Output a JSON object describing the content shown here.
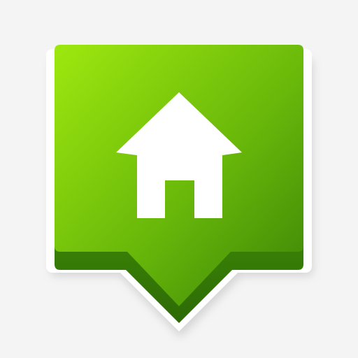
{
  "icon": {
    "name": "home-location-pin-icon",
    "colors": {
      "background": "#f4f4f4",
      "pin_light": "#9ee80f",
      "pin_mid": "#69b80a",
      "pin_dark": "#3b8407",
      "pin_tip": "#2d6a05",
      "house": "#ffffff",
      "shadow": "#bdbdbd"
    }
  }
}
